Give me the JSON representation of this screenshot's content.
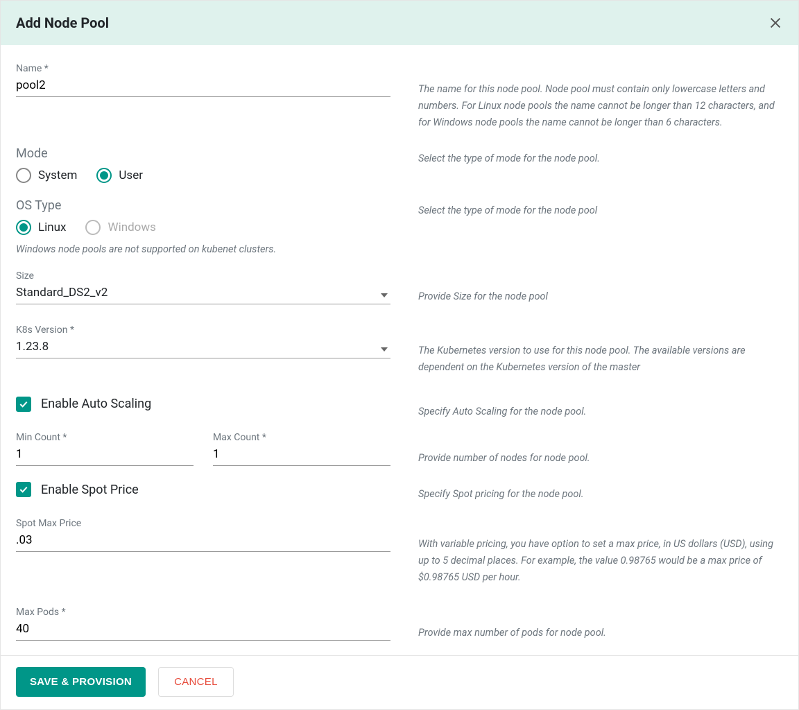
{
  "dialog": {
    "title": "Add Node Pool"
  },
  "fields": {
    "name": {
      "label": "Name *",
      "value": "pool2",
      "help": "The name for this node pool. Node pool must contain only lowercase letters and numbers. For Linux node pools the name cannot be longer than 12 characters, and for Windows node pools the name cannot be longer than 6 characters."
    },
    "mode": {
      "label": "Mode",
      "options": {
        "system": "System",
        "user": "User"
      },
      "selected": "user",
      "help": "Select the type of mode for the node pool."
    },
    "ostype": {
      "label": "OS Type",
      "options": {
        "linux": "Linux",
        "windows": "Windows"
      },
      "selected": "linux",
      "hint": "Windows node pools are not supported on kubenet clusters.",
      "help": "Select the type of mode for the node pool"
    },
    "size": {
      "label": "Size",
      "value": "Standard_DS2_v2",
      "help": "Provide Size for the node pool"
    },
    "k8s": {
      "label": "K8s Version *",
      "value": "1.23.8",
      "help": "The Kubernetes version to use for this node pool. The available versions are dependent on the Kubernetes version of the master"
    },
    "autoscaling": {
      "label": "Enable Auto Scaling",
      "checked": true,
      "help": "Specify Auto Scaling for the node pool."
    },
    "mincount": {
      "label": "Min Count *",
      "value": "1"
    },
    "maxcount": {
      "label": "Max Count *",
      "value": "1",
      "help": "Provide number of nodes for node pool."
    },
    "spotprice": {
      "label": "Enable Spot Price",
      "checked": true,
      "help": "Specify Spot pricing for the node pool."
    },
    "spotmax": {
      "label": "Spot Max Price",
      "value": ".03",
      "help": "With variable pricing, you have option to set a max price, in US dollars (USD), using up to 5 decimal places. For example, the value 0.98765 would be a max price of $0.98765 USD per hour."
    },
    "maxpods": {
      "label": "Max Pods *",
      "value": "40",
      "help": "Provide max number of pods for node pool."
    }
  },
  "buttons": {
    "save": "SAVE & PROVISION",
    "cancel": "CANCEL"
  }
}
